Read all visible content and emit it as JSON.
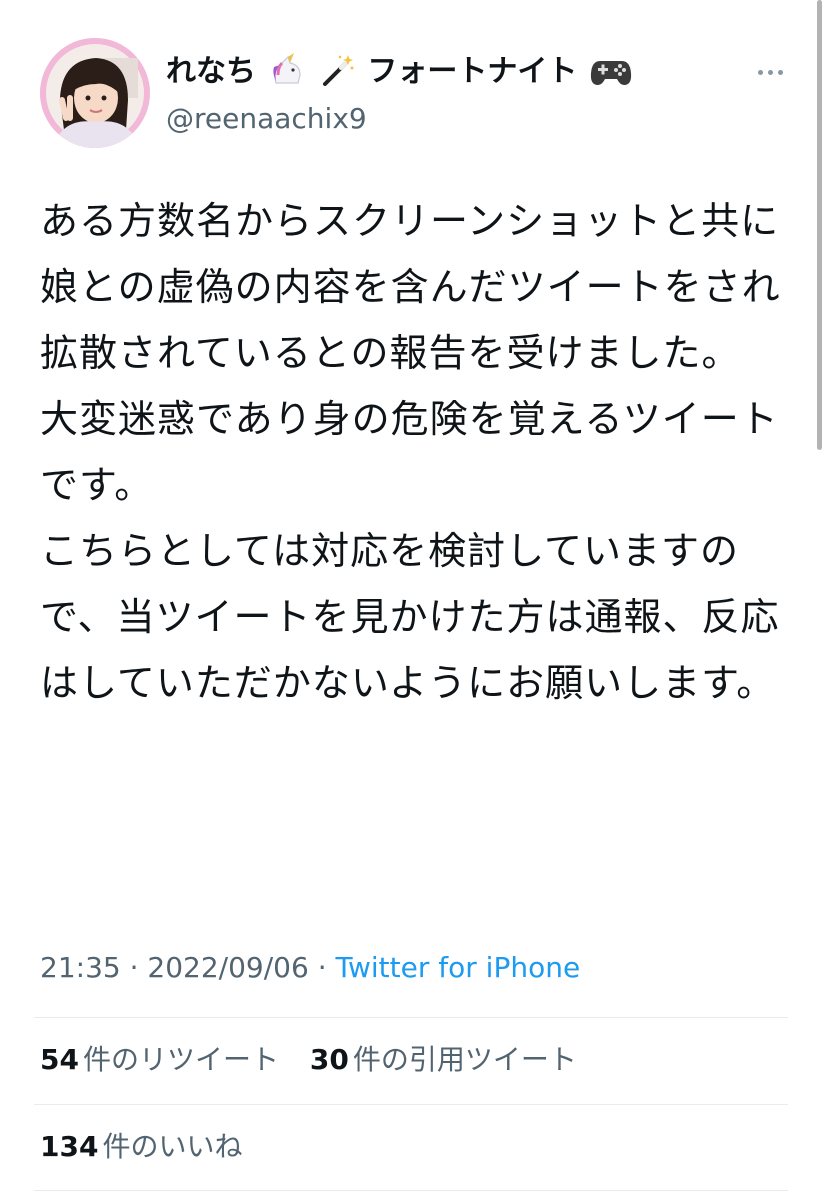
{
  "user": {
    "display_name": "れなち",
    "display_name_suffix": "フォートナイト",
    "handle": "@reenaachix9",
    "emojis": [
      "unicorn-icon",
      "magic-wand-icon",
      "game-controller-icon"
    ]
  },
  "tweet": {
    "text": "ある方数名からスクリーンショットと共に\n娘との虚偽の内容を含んだツイートをされ拡散されているとの報告を受けました。\n大変迷惑であり身の危険を覚えるツイートです。\nこちらとしては対応を検討していますので、当ツイートを見かけた方は通報、反応はしていただかないようにお願いします。",
    "time": "21:35",
    "separator": "·",
    "date": "2022/09/06",
    "source": "Twitter for iPhone"
  },
  "stats": {
    "retweets_count": "54",
    "retweets_label": "件のリツイート",
    "quotes_count": "30",
    "quotes_label": "件の引用ツイート",
    "likes_count": "134",
    "likes_label": "件のいいね"
  },
  "colors": {
    "link": "#1d9bf0",
    "secondary_text": "#536471",
    "avatar_ring": "#f2b8d8"
  }
}
